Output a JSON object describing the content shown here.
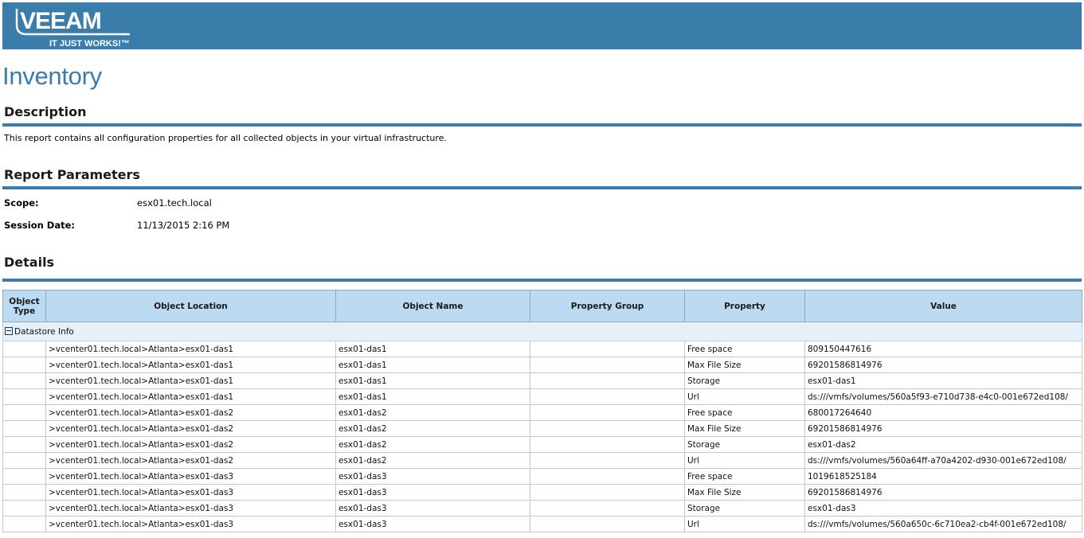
{
  "header": {
    "logo_text": "VEEAM",
    "tagline": "IT JUST WORKS!™",
    "brand_color": "#3a7daa"
  },
  "report": {
    "title": "Inventory",
    "description_heading": "Description",
    "description_text": "This report contains all configuration properties for all collected objects in your virtual infrastructure.",
    "parameters_heading": "Report Parameters",
    "parameters": [
      {
        "label": "Scope:",
        "value": "esx01.tech.local"
      },
      {
        "label": "Session Date:",
        "value": "11/13/2015 2:16 PM"
      }
    ],
    "details_heading": "Details"
  },
  "table": {
    "columns": [
      "Object Type",
      "Object Location",
      "Object Name",
      "Property Group",
      "Property",
      "Value"
    ],
    "group_label": "Datastore Info",
    "rows": [
      [
        "",
        ">vcenter01.tech.local>Atlanta>esx01-das1",
        "esx01-das1",
        "",
        "Free space",
        "809150447616"
      ],
      [
        "",
        ">vcenter01.tech.local>Atlanta>esx01-das1",
        "esx01-das1",
        "",
        "Max File Size",
        "69201586814976"
      ],
      [
        "",
        ">vcenter01.tech.local>Atlanta>esx01-das1",
        "esx01-das1",
        "",
        "Storage",
        "esx01-das1"
      ],
      [
        "",
        ">vcenter01.tech.local>Atlanta>esx01-das1",
        "esx01-das1",
        "",
        "Url",
        "ds:///vmfs/volumes/560a5f93-e710d738-e4c0-001e672ed108/"
      ],
      [
        "",
        ">vcenter01.tech.local>Atlanta>esx01-das2",
        "esx01-das2",
        "",
        "Free space",
        "680017264640"
      ],
      [
        "",
        ">vcenter01.tech.local>Atlanta>esx01-das2",
        "esx01-das2",
        "",
        "Max File Size",
        "69201586814976"
      ],
      [
        "",
        ">vcenter01.tech.local>Atlanta>esx01-das2",
        "esx01-das2",
        "",
        "Storage",
        "esx01-das2"
      ],
      [
        "",
        ">vcenter01.tech.local>Atlanta>esx01-das2",
        "esx01-das2",
        "",
        "Url",
        "ds:///vmfs/volumes/560a64ff-a70a4202-d930-001e672ed108/"
      ],
      [
        "",
        ">vcenter01.tech.local>Atlanta>esx01-das3",
        "esx01-das3",
        "",
        "Free space",
        "1019618525184"
      ],
      [
        "",
        ">vcenter01.tech.local>Atlanta>esx01-das3",
        "esx01-das3",
        "",
        "Max File Size",
        "69201586814976"
      ],
      [
        "",
        ">vcenter01.tech.local>Atlanta>esx01-das3",
        "esx01-das3",
        "",
        "Storage",
        "esx01-das3"
      ],
      [
        "",
        ">vcenter01.tech.local>Atlanta>esx01-das3",
        "esx01-das3",
        "",
        "Url",
        "ds:///vmfs/volumes/560a650c-6c710ea2-cb4f-001e672ed108/"
      ]
    ]
  }
}
